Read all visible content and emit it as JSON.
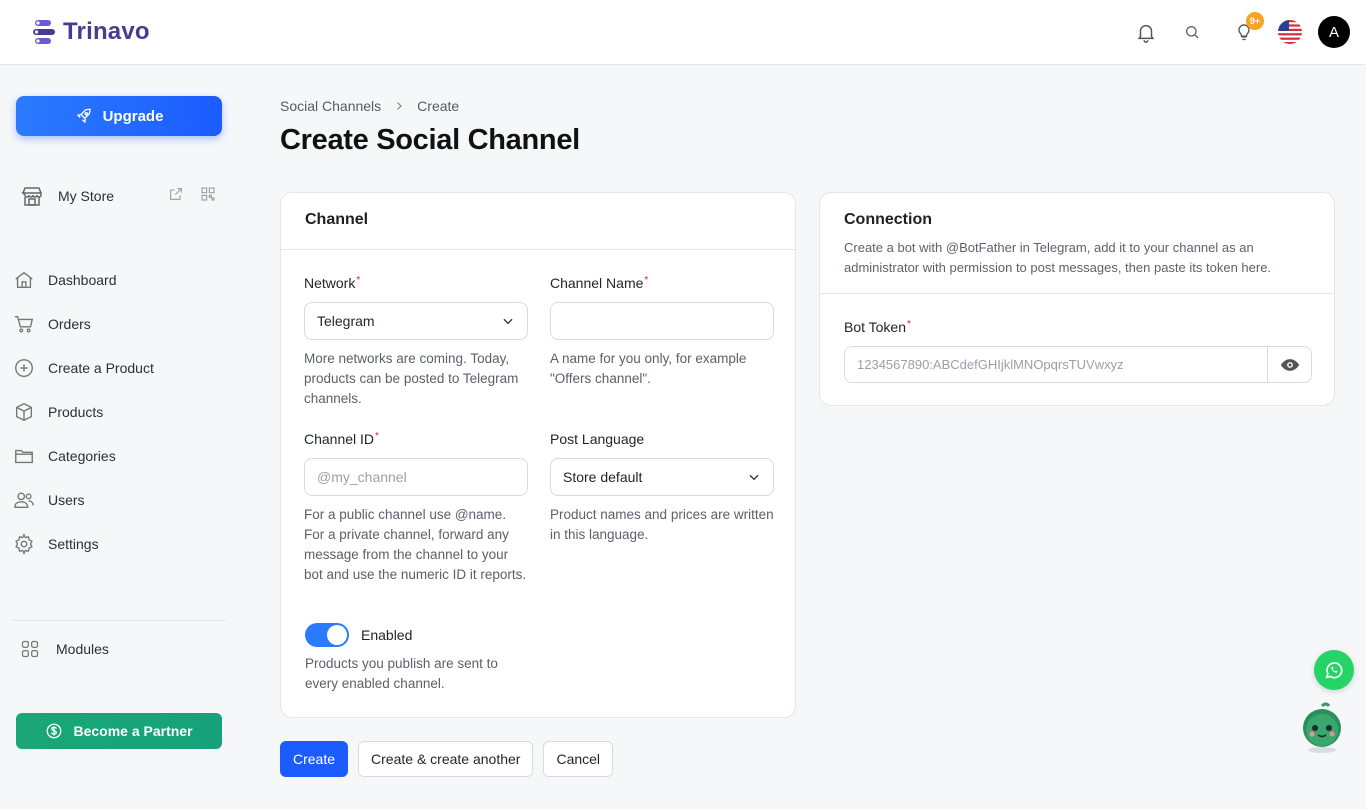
{
  "app": {
    "brand": "Trinavo"
  },
  "header": {
    "notification_badge": "9+",
    "avatar_initial": "A"
  },
  "sidebar": {
    "upgrade_label": "Upgrade",
    "store_label": "My Store",
    "items": [
      {
        "label": "Dashboard",
        "icon": "home-icon"
      },
      {
        "label": "Orders",
        "icon": "cart-icon"
      },
      {
        "label": "Create a Product",
        "icon": "plus-circle-icon"
      },
      {
        "label": "Products",
        "icon": "box-icon"
      },
      {
        "label": "Categories",
        "icon": "folder-icon"
      },
      {
        "label": "Users",
        "icon": "users-icon"
      },
      {
        "label": "Settings",
        "icon": "gear-icon"
      }
    ],
    "modules_label": "Modules",
    "partner_label": "Become a Partner"
  },
  "breadcrumb": {
    "parent": "Social Channels",
    "current": "Create"
  },
  "page": {
    "title": "Create Social Channel"
  },
  "channel_card": {
    "title": "Channel",
    "network": {
      "label": "Network",
      "value": "Telegram",
      "help": "More networks are coming. Today, products can be posted to Telegram channels."
    },
    "channel_name": {
      "label": "Channel Name",
      "value": "",
      "placeholder": "",
      "help": "A name for you only, for example \"Offers channel\"."
    },
    "channel_id": {
      "label": "Channel ID",
      "value": "",
      "placeholder": "@my_channel",
      "help": "For a public channel use @name. For a private channel, forward any message from the channel to your bot and use the numeric ID it reports."
    },
    "post_language": {
      "label": "Post Language",
      "value": "Store default",
      "help": "Product names and prices are written in this language."
    },
    "enabled": {
      "label": "Enabled",
      "checked": true,
      "help": "Products you publish are sent to every enabled channel."
    }
  },
  "connection_card": {
    "title": "Connection",
    "description": "Create a bot with @BotFather in Telegram, add it to your channel as an administrator with permission to post messages, then paste its token here.",
    "bot_token": {
      "label": "Bot Token",
      "value": "",
      "placeholder": "1234567890:ABCdefGHIjklMNOpqrsTUVwxyz"
    }
  },
  "actions": {
    "create": "Create",
    "create_another": "Create & create another",
    "cancel": "Cancel"
  },
  "colors": {
    "primary": "#1b5cff",
    "partner": "#15a27a",
    "brand": "#4b3a8f",
    "whatsapp": "#25d366"
  }
}
